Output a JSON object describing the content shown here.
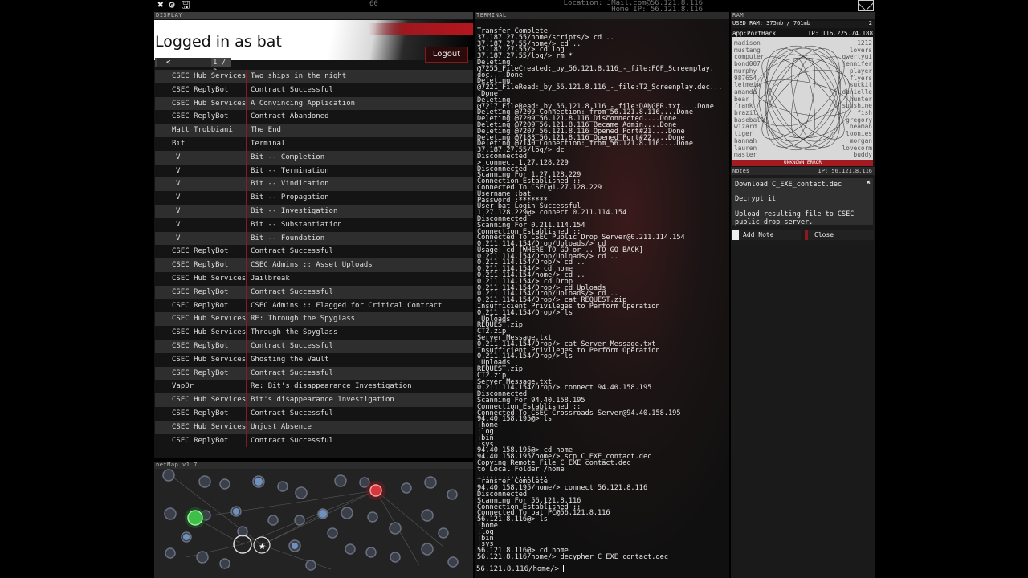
{
  "topbar": {
    "fps": "60",
    "location_line1": "Location: JMail.com@56.121.8.116",
    "location_line2": "Home IP: 56.121.8.116",
    "icons": [
      "close-icon",
      "gear-icon",
      "save-icon",
      "mail-icon"
    ]
  },
  "display": {
    "label": "DISPLAY",
    "title": "Logged in as bat",
    "logout_label": "Logout",
    "pager_prev": "<",
    "pager_text": "1 / 3",
    "emails": [
      {
        "from": "CSEC Hub Services",
        "subject": "Two ships in the night"
      },
      {
        "from": "CSEC ReplyBot",
        "subject": "Contract Successful"
      },
      {
        "from": "CSEC Hub Services",
        "subject": "A Convincing Application"
      },
      {
        "from": "CSEC ReplyBot",
        "subject": "Contract Abandoned"
      },
      {
        "from": "Matt Trobbiani",
        "subject": "The End"
      },
      {
        "from": "Bit",
        "subject": "Terminal"
      },
      {
        "from": "V",
        "subject": "Bit -- Completion"
      },
      {
        "from": "V",
        "subject": "Bit -- Termination"
      },
      {
        "from": "V",
        "subject": "Bit -- Vindication"
      },
      {
        "from": "V",
        "subject": "Bit -- Propagation"
      },
      {
        "from": "V",
        "subject": "Bit -- Investigation"
      },
      {
        "from": "V",
        "subject": "Bit -- Substantiation"
      },
      {
        "from": "V",
        "subject": "Bit -- Foundation"
      },
      {
        "from": "CSEC ReplyBot",
        "subject": "Contract Successful"
      },
      {
        "from": "CSEC ReplyBot",
        "subject": "CSEC Admins :: Asset Uploads"
      },
      {
        "from": "CSEC Hub Services",
        "subject": "Jailbreak"
      },
      {
        "from": "CSEC ReplyBot",
        "subject": "Contract Successful"
      },
      {
        "from": "CSEC ReplyBot",
        "subject": "CSEC Admins :: Flagged for Critical Contract"
      },
      {
        "from": "CSEC Hub Services",
        "subject": "RE: Through the Spyglass"
      },
      {
        "from": "CSEC Hub Services",
        "subject": "Through the Spyglass"
      },
      {
        "from": "CSEC ReplyBot",
        "subject": "Contract Successful"
      },
      {
        "from": "CSEC Hub Services",
        "subject": "Ghosting the Vault"
      },
      {
        "from": "CSEC ReplyBot",
        "subject": "Contract Successful"
      },
      {
        "from": "Vap0r",
        "subject": "Re: Bit's disappearance Investigation"
      },
      {
        "from": "CSEC Hub Services",
        "subject": "Bit's disappearance Investigation"
      },
      {
        "from": "CSEC ReplyBot",
        "subject": "Contract Successful"
      },
      {
        "from": "CSEC Hub Services",
        "subject": "Unjust Absence"
      },
      {
        "from": "CSEC ReplyBot",
        "subject": "Contract Successful"
      }
    ]
  },
  "netmap": {
    "label": "netMap v1.7"
  },
  "terminal": {
    "label": "TERMINAL",
    "lines": [
      "Transfer Complete",
      "37.187.27.55/home/scripts/> cd ..",
      "37.187.27.55/home/> cd ..",
      "37.187.27.55/> cd log",
      "37.187.27.55/log/> rm *",
      "Deleting",
      "@7255_FileCreated:_by_56.121.8.116_-_file:FOF_Screenplay.",
      "doc....Done",
      "Deleting",
      "@7221_FileRead:_by_56.121.8.116_-_file:T2_Screenplay.dec...",
      ".Done",
      "Deleting",
      "@7217_FileRead:_by_56.121.8.116_-_file:DANGER.txt....Done",
      "Deleting @7209_Connection:_from_56.121.8.116....Done",
      "Deleting @7209_56.121.8.116_Disconnected....Done",
      "Deleting @7209_56.121.8.116_Became_Admin....Done",
      "Deleting @7207_56.121.8.116_Opened_Port#21....Done",
      "Deleting @7183_56.121.8.116_Opened_Port#22....Done",
      "Deleting @7140_Connection:_from_56.121.8.116....Done",
      "37.187.27.55/log/> dc",
      "Disconnected",
      "> connect 1.27.128.229",
      "Disconnected",
      "Scanning For 1.27.128.229",
      "Connection Established ::",
      "Connected To CSEC@1.27.128.229",
      "Username :bat",
      "Password :*******",
      "User bat Login Successful",
      "1.27.128.229@> connect 0.211.114.154",
      "Disconnected",
      "Scanning For 0.211.114.154",
      "Connection Established ::",
      "Connected To CSEC Public Drop Server@0.211.114.154",
      "0.211.114.154/Drop/Uploads/> cd",
      "Usage: cd [WHERE TO GO or .. TO GO BACK]",
      "0.211.114.154/Drop/Uploads/> cd ..",
      "0.211.114.154/Drop/> cd ..",
      "0.211.114.154/> cd home",
      "0.211.114.154/home/> cd ..",
      "0.211.114.154/> cd Drop",
      "0.211.114.154/Drop/> cd Uploads",
      "0.211.114.154/Drop/Uploads/> cd ..",
      "0.211.114.154/Drop/> cat REQUEST.zip",
      "Insufficient Privileges to Perform Operation",
      "0.211.114.154/Drop/> ls",
      ":Uploads",
      "REQUEST.zip",
      "CT2.zip",
      "Server_Message.txt",
      "0.211.114.154/Drop/> cat Server_Message.txt",
      "Insufficient Privileges to Perform Operation",
      "0.211.114.154/Drop/> ls",
      ":Uploads",
      "REQUEST.zip",
      "CT2.zip",
      "Server_Message.txt",
      "0.211.114.154/Drop/> connect 94.40.158.195",
      "Disconnected",
      "Scanning For 94.40.158.195",
      "Connection Established ::",
      "Connected To CSEC Crossroads Server@94.40.158.195",
      "94.40.158.195@> ls",
      ":home",
      ":log",
      ":bin",
      ":sys",
      "94.40.158.195@> cd home",
      "94.40.158.195/home/> scp C_EXE_contact.dec",
      "Copying Remote File C_EXE_contact.dec",
      "to Local Folder /home",
      ".................",
      "Transfer Complete",
      "94.40.158.195/home/> connect 56.121.8.116",
      "Disconnected",
      "Scanning For 56.121.8.116",
      "Connection Established ::",
      "Connected To bat PC@56.121.8.116",
      "56.121.8.116@> ls",
      ":home",
      ":log",
      ":bin",
      ":sys",
      "56.121.8.116@> cd home",
      "56.121.8.116/home/> decypher C_EXE_contact.dec"
    ],
    "prompt": "56.121.8.116/home/> "
  },
  "ram": {
    "label": "RAM",
    "used": "USED RAM: 375mb / 761mb",
    "count": "2",
    "app_title": "app:PortHack",
    "app_ip": "IP: 116.225.74.188",
    "wordlist_left": "madison\nmustang\ncomputer\nbond007\nmurphy\n987654\nletmein\namanda\nbear\nfrank\nbrazil\nbaseball\nwizard\ntiger\nhannah\nlauren\nmaster",
    "wordlist_right": "1212\nlovers\nqwertyui\njennifer\nplayer\nflyers\nsuckit\ndanielle\nhunter\nsunshine\nfish\ngregory\nbeaman\nloonies\nmorgan\nlovecorm\nbuddy",
    "error": "UNKNOWN ERROR"
  },
  "notes": {
    "label": "Notes",
    "ip": "IP: 56.121.8.116",
    "note1": "Download C_EXE_contact.dec",
    "note2": "Decrypt it",
    "note3": "Upload resulting file to CSEC public drop server.",
    "add_label": "Add Note",
    "close_label": "Close"
  }
}
